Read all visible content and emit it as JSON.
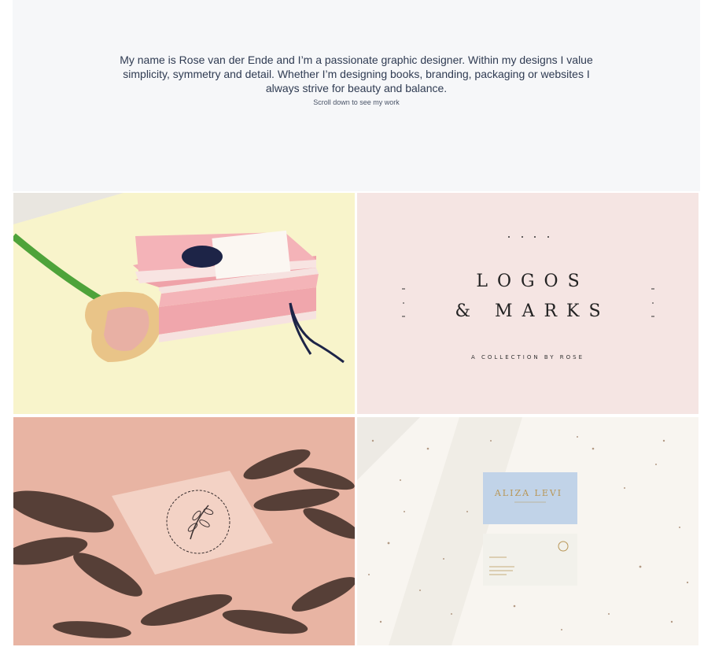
{
  "intro": {
    "text": "My name is Rose van der Ende and I’m a passionate graphic designer. Within my designs I value simplicity, symmetry and detail. Whether I’m designing books, branding, packaging or websites I always strive for beauty and balance.",
    "scroll_label": "Scroll down to see my work"
  },
  "portfolio": {
    "tiles": [
      {
        "subject": "pink book stack with calla lily"
      },
      {
        "subject": "logos and marks collection",
        "title_line1": "LOGOS",
        "title_line2": "& MARKS",
        "subtitle": "A COLLECTION BY ROSE"
      },
      {
        "subject": "business card on pink background with leaf shadows"
      },
      {
        "subject": "business card mockup on speckled paper",
        "card_name": "ALIZA LEVI"
      }
    ]
  },
  "colors": {
    "intro_bg": "#f6f7f9",
    "intro_text": "#2f3b52",
    "tile1_bg": "#f7f3c9",
    "tile2_bg": "#f5e5e3",
    "tile3_bg": "#e7b2a0",
    "tile4_bg": "#f7f4ef"
  }
}
